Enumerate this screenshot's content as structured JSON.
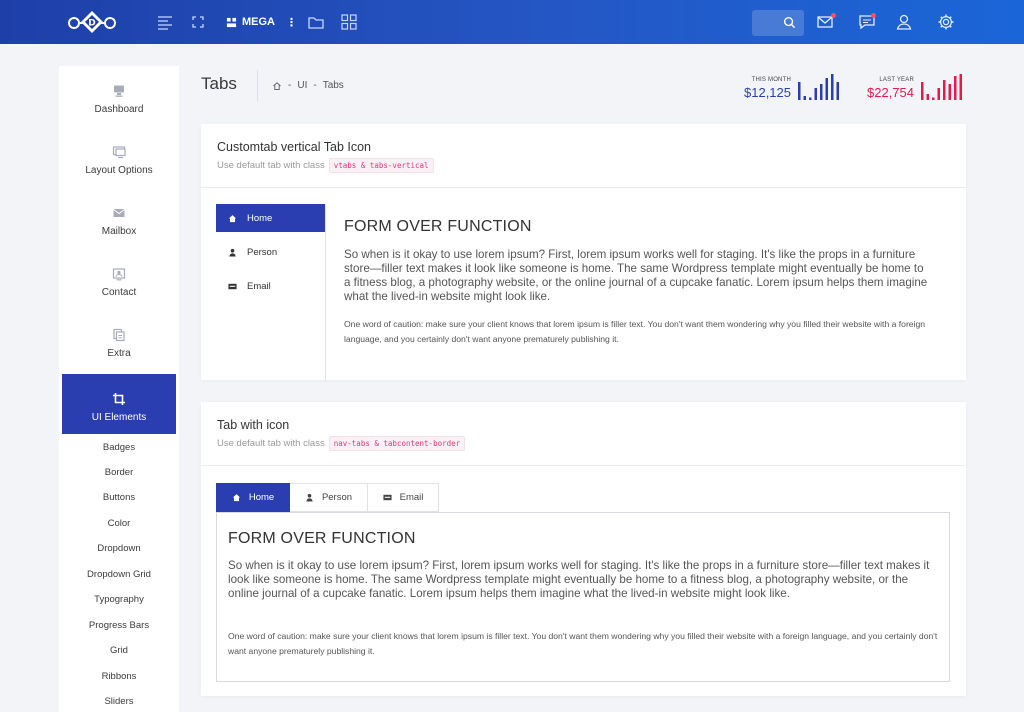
{
  "topbar": {
    "mega_label": "MEGA",
    "mega_more": "⋮",
    "icons": [
      "menu-icon",
      "fullscreen-icon",
      "grid-icon",
      "folder-icon",
      "apps-icon",
      "search-icon",
      "mail-icon",
      "chat-icon",
      "user-icon",
      "gear-icon"
    ]
  },
  "sidebar": {
    "main_items": [
      {
        "label": "Dashboard",
        "icon": "desktop-icon"
      },
      {
        "label": "Layout Options",
        "icon": "monitor-icon"
      },
      {
        "label": "Mailbox",
        "icon": "envelope-icon"
      },
      {
        "label": "Contact",
        "icon": "contact-icon"
      },
      {
        "label": "Extra",
        "icon": "copy-icon"
      },
      {
        "label": "UI Elements",
        "icon": "crop-icon",
        "active": true
      }
    ],
    "sub_items": [
      "Badges",
      "Border",
      "Buttons",
      "Color",
      "Dropdown",
      "Dropdown Grid",
      "Typography",
      "Progress Bars",
      "Grid",
      "Ribbons",
      "Sliders"
    ]
  },
  "header": {
    "title": "Tabs",
    "breadcrumb": [
      "UI",
      "Tabs"
    ],
    "breadcrumb_sep": "-",
    "stats": [
      {
        "label": "THIS MONTH",
        "value": "$12,125",
        "color": "#2a3eb1"
      },
      {
        "label": "LAST YEAR",
        "value": "$22,754",
        "color": "#e8174e"
      }
    ]
  },
  "card1": {
    "title": "Customtab vertical Tab Icon",
    "subtitle": "Use default tab with class",
    "code": "vtabs & tabs-vertical",
    "tabs": [
      {
        "label": "Home",
        "icon": "home-icon",
        "active": true
      },
      {
        "label": "Person",
        "icon": "person-icon"
      },
      {
        "label": "Email",
        "icon": "email-icon"
      }
    ],
    "content_title": "FORM OVER FUNCTION",
    "content_para": "So when is it okay to use lorem ipsum? First, lorem ipsum works well for staging. It's like the props in a furniture store—filler text makes it look like someone is home. The same Wordpress template might eventually be home to a fitness blog, a photography website, or the online journal of a cupcake fanatic. Lorem ipsum helps them imagine what the lived-in website might look like.",
    "content_small": "One word of caution: make sure your client knows that lorem ipsum is filler text. You don't want them wondering why you filled their website with a foreign language, and you certainly don't want anyone prematurely publishing it."
  },
  "card2": {
    "title": "Tab with icon",
    "subtitle": "Use default tab with class",
    "code": "nav-tabs & tabcontent-border",
    "tabs": [
      {
        "label": "Home",
        "icon": "home-icon",
        "active": true
      },
      {
        "label": "Person",
        "icon": "person-icon"
      },
      {
        "label": "Email",
        "icon": "email-icon"
      }
    ],
    "content_title": "FORM OVER FUNCTION",
    "content_para": "So when is it okay to use lorem ipsum? First, lorem ipsum works well for staging. It's like the props in a furniture store—filler text makes it look like someone is home. The same Wordpress template might eventually be home to a fitness blog, a photography website, or the online journal of a cupcake fanatic. Lorem ipsum helps them imagine what the lived-in website might look like.",
    "content_small": "One word of caution: make sure your client knows that lorem ipsum is filler text. You don't want them wondering why you filled their website with a foreign language, and you certainly don't want anyone prematurely publishing it."
  },
  "colors": {
    "accent": "#2a3eb1",
    "danger": "#e8174e",
    "topbar": "#2457c5"
  }
}
